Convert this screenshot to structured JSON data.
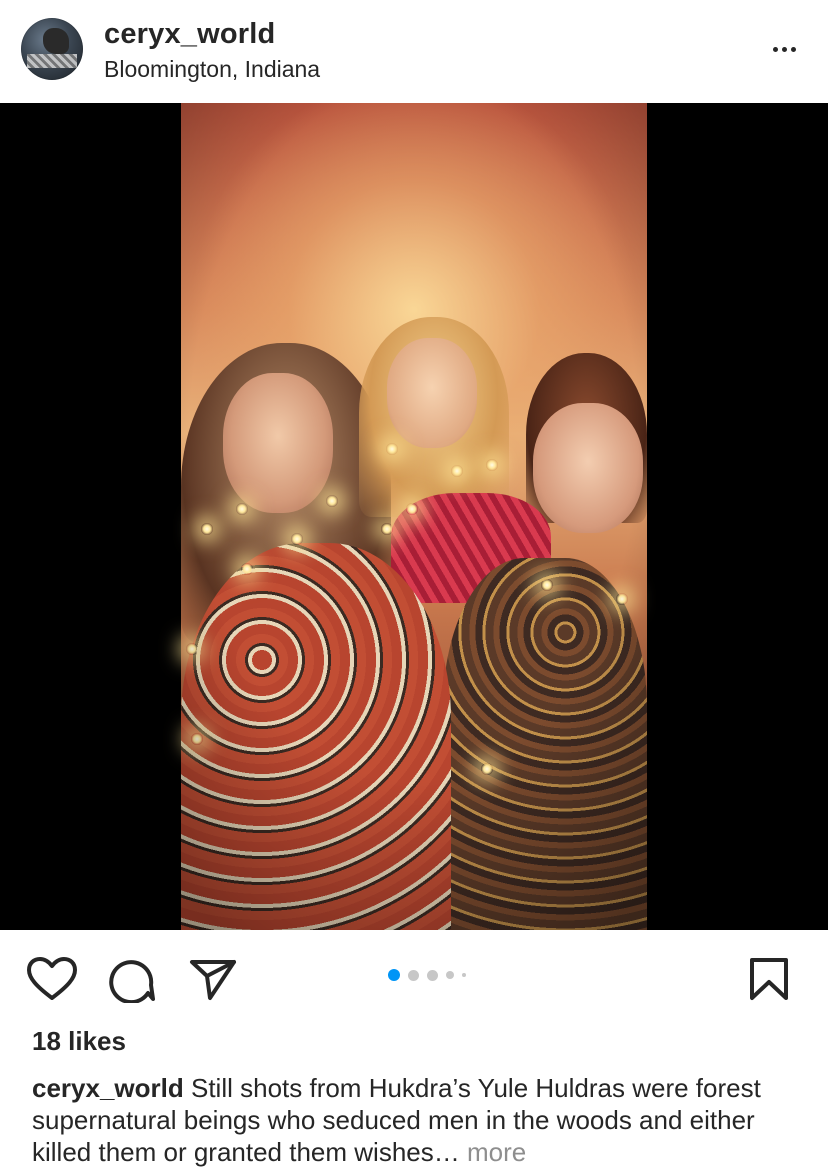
{
  "post": {
    "username": "ceryx_world",
    "location": "Bloomington, Indiana",
    "likes": "18 likes",
    "caption": {
      "username": "ceryx_world",
      "text": "Still shots from Hukdra’s Yule Huldras were forest supernatural beings who seduced men in the woods and either killed them or granted them wishes",
      "ellipsis": "…",
      "more_label": "more"
    },
    "carousel": {
      "total": 5,
      "active_index": 0
    }
  },
  "icons": {
    "more": "more-options-icon",
    "like": "heart-icon",
    "comment": "comment-bubble-icon",
    "share": "paper-plane-icon",
    "save": "bookmark-icon"
  },
  "colors": {
    "text": "#262626",
    "accent": "#0095f6",
    "muted": "#8e8e8e",
    "dot_inactive": "#c7c7c7",
    "media_background": "#000000"
  }
}
